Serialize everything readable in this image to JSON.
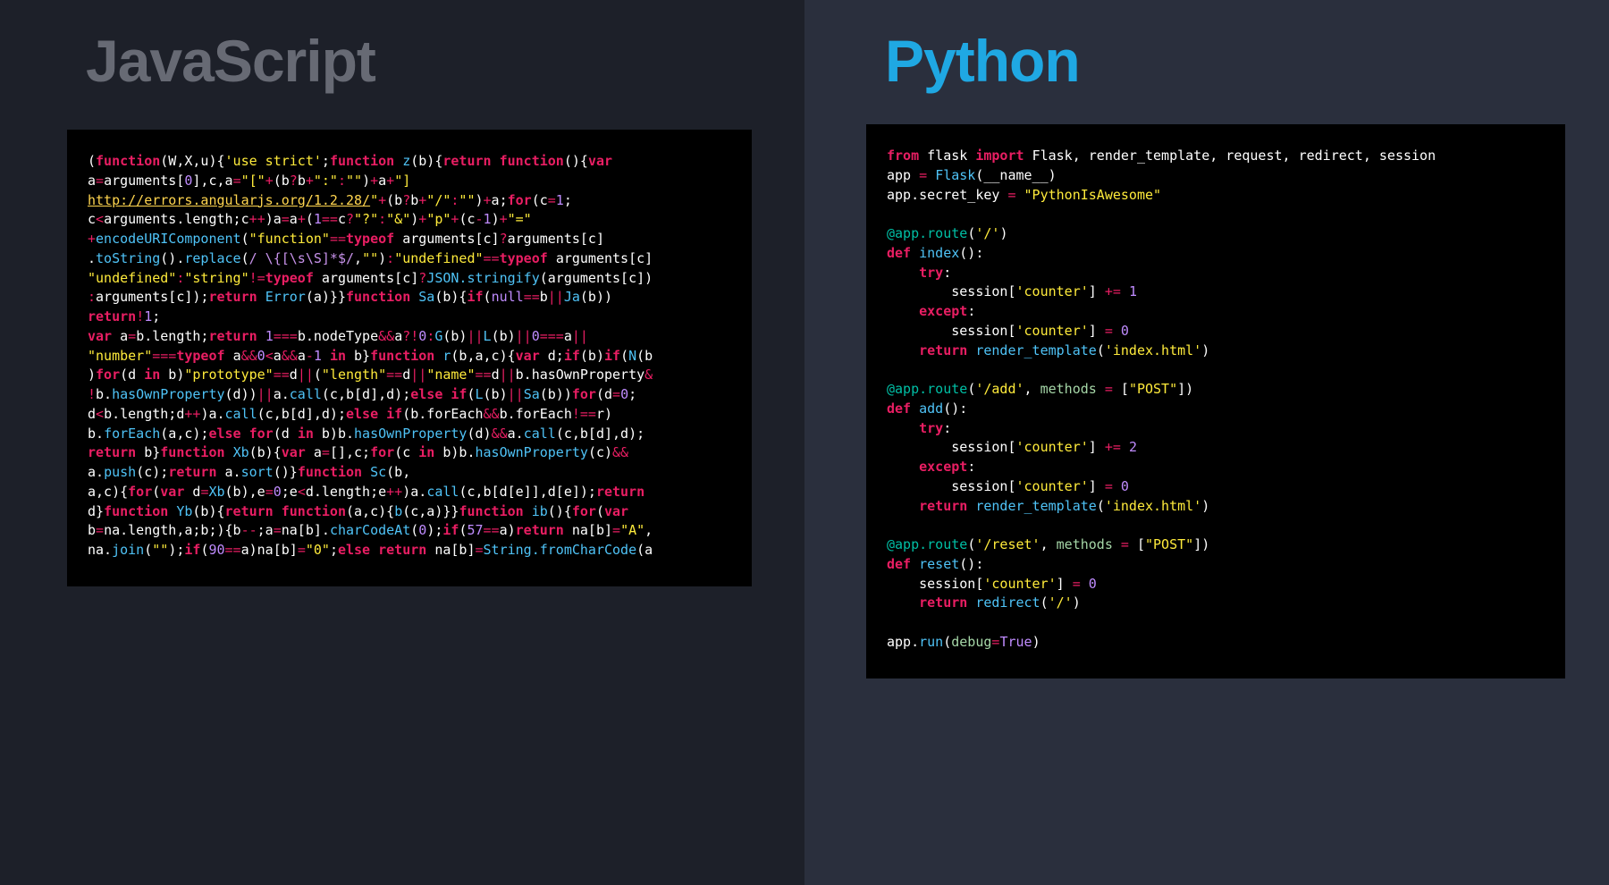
{
  "left": {
    "title": "JavaScript",
    "code_html": "<span class='wht'>(</span><span class='kw'>function</span><span class='wht'>(W,X,u){</span><span class='str'>'use strict'</span><span class='wht'>;</span><span class='kw'>function</span> <span class='fn'>z</span><span class='wht'>(b){</span><span class='kw'>return</span> <span class='kw'>function</span><span class='wht'>(){</span><span class='kw'>var</span>\n<span class='wht'>a</span><span class='op'>=</span><span class='wht'>arguments[</span><span class='num'>0</span><span class='wht'>],c,a</span><span class='op'>=</span><span class='str'>\"[\"</span><span class='op'>+</span><span class='wht'>(b</span><span class='op'>?</span><span class='wht'>b</span><span class='op'>+</span><span class='str'>\":\"</span><span class='op'>:</span><span class='str'>\"\"</span><span class='wht'>)</span><span class='op'>+</span><span class='wht'>a</span><span class='op'>+</span><span class='str'>\"]</span>\n<span class='url'>http://errors.angularjs.org/1.2.28/</span><span class='str'>\"</span><span class='op'>+</span><span class='wht'>(b</span><span class='op'>?</span><span class='wht'>b</span><span class='op'>+</span><span class='str'>\"/\"</span><span class='op'>:</span><span class='str'>\"\"</span><span class='wht'>)</span><span class='op'>+</span><span class='wht'>a;</span><span class='kw'>for</span><span class='wht'>(c</span><span class='op'>=</span><span class='num'>1</span><span class='wht'>;\nc</span><span class='op'>&lt;</span><span class='wht'>arguments.length;c</span><span class='op'>++</span><span class='wht'>)a</span><span class='op'>=</span><span class='wht'>a</span><span class='op'>+</span><span class='wht'>(</span><span class='num'>1</span><span class='op'>==</span><span class='wht'>c</span><span class='op'>?</span><span class='str'>\"?\"</span><span class='op'>:</span><span class='str'>\"&amp;\"</span><span class='wht'>)</span><span class='op'>+</span><span class='str'>\"p\"</span><span class='op'>+</span><span class='wht'>(c</span><span class='op'>-</span><span class='num'>1</span><span class='wht'>)</span><span class='op'>+</span><span class='str'>\"=\"</span>\n<span class='op'>+</span><span class='fn'>encodeURIComponent</span><span class='wht'>(</span><span class='str'>\"function\"</span><span class='op'>==</span><span class='kw'>typeof</span> <span class='wht'>arguments[c]</span><span class='op'>?</span><span class='wht'>arguments[c]</span>\n<span class='wht'>.</span><span class='fn'>toString</span><span class='wht'>().</span><span class='fn'>replace</span><span class='wht'>(</span><span class='lav'>/ \\{[\\s\\S]*$/</span><span class='wht'>,</span><span class='str'>\"\"</span><span class='wht'>)</span><span class='op'>:</span><span class='str'>\"undefined\"</span><span class='op'>==</span><span class='kw'>typeof</span> <span class='wht'>arguments[c]</span>\n<span class='str'>\"undefined\"</span><span class='op'>:</span><span class='str'>\"string\"</span><span class='op'>!=</span><span class='kw'>typeof</span> <span class='wht'>arguments[c]</span><span class='op'>?</span><span class='fn'>JSON.stringify</span><span class='wht'>(arguments[c])</span>\n<span class='op'>:</span><span class='wht'>arguments[c]);</span><span class='kw'>return</span> <span class='fn'>Error</span><span class='wht'>(a)}}</span><span class='kw'>function</span> <span class='fn'>Sa</span><span class='wht'>(b){</span><span class='kw'>if</span><span class='wht'>(</span><span class='num'>null</span><span class='op'>==</span><span class='wht'>b</span><span class='op'>||</span><span class='fn'>Ja</span><span class='wht'>(b))</span>\n<span class='kw'>return</span><span class='op'>!</span><span class='num'>1</span><span class='wht'>;</span>\n<span class='kw'>var</span> <span class='wht'>a</span><span class='op'>=</span><span class='wht'>b.length;</span><span class='kw'>return</span> <span class='num'>1</span><span class='op'>===</span><span class='wht'>b.nodeType</span><span class='op'>&amp;&amp;</span><span class='wht'>a</span><span class='op'>?!</span><span class='num'>0</span><span class='op'>:</span><span class='fn'>G</span><span class='wht'>(b)</span><span class='op'>||</span><span class='fn'>L</span><span class='wht'>(b)</span><span class='op'>||</span><span class='num'>0</span><span class='op'>===</span><span class='wht'>a</span><span class='op'>||</span>\n<span class='str'>\"number\"</span><span class='op'>===</span><span class='kw'>typeof</span> <span class='wht'>a</span><span class='op'>&amp;&amp;</span><span class='num'>0</span><span class='op'>&lt;</span><span class='wht'>a</span><span class='op'>&amp;&amp;</span><span class='wht'>a</span><span class='op'>-</span><span class='num'>1</span> <span class='kw'>in</span> <span class='wht'>b}</span><span class='kw'>function</span> <span class='fn'>r</span><span class='wht'>(b,a,c){</span><span class='kw'>var</span> <span class='wht'>d;</span><span class='kw'>if</span><span class='wht'>(b)</span><span class='kw'>if</span><span class='wht'>(</span><span class='fn'>N</span><span class='wht'>(b</span>\n<span class='wht'>)</span><span class='kw'>for</span><span class='wht'>(d </span><span class='kw'>in</span><span class='wht'> b)</span><span class='str'>\"prototype\"</span><span class='op'>==</span><span class='wht'>d</span><span class='op'>||</span><span class='wht'>(</span><span class='str'>\"length\"</span><span class='op'>==</span><span class='wht'>d</span><span class='op'>||</span><span class='str'>\"name\"</span><span class='op'>==</span><span class='wht'>d</span><span class='op'>||</span><span class='wht'>b.hasOwnProperty</span><span class='op'>&amp;</span>\n<span class='op'>!</span><span class='wht'>b.</span><span class='fn'>hasOwnProperty</span><span class='wht'>(d))</span><span class='op'>||</span><span class='wht'>a.</span><span class='fn'>call</span><span class='wht'>(c,b[d],d);</span><span class='kw'>else if</span><span class='wht'>(</span><span class='fn'>L</span><span class='wht'>(b)</span><span class='op'>||</span><span class='fn'>Sa</span><span class='wht'>(b))</span><span class='kw'>for</span><span class='wht'>(d</span><span class='op'>=</span><span class='num'>0</span><span class='wht'>;</span>\n<span class='wht'>d</span><span class='op'>&lt;</span><span class='wht'>b.length;d</span><span class='op'>++</span><span class='wht'>)a.</span><span class='fn'>call</span><span class='wht'>(c,b[d],d);</span><span class='kw'>else if</span><span class='wht'>(b.forEach</span><span class='op'>&amp;&amp;</span><span class='wht'>b.forEach</span><span class='op'>!==</span><span class='wht'>r)</span>\n<span class='wht'>b.</span><span class='fn'>forEach</span><span class='wht'>(a,c);</span><span class='kw'>else for</span><span class='wht'>(d </span><span class='kw'>in</span><span class='wht'> b)b.</span><span class='fn'>hasOwnProperty</span><span class='wht'>(d)</span><span class='op'>&amp;&amp;</span><span class='wht'>a.</span><span class='fn'>call</span><span class='wht'>(c,b[d],d);</span>\n<span class='kw'>return</span> <span class='wht'>b}</span><span class='kw'>function</span> <span class='fn'>Xb</span><span class='wht'>(b){</span><span class='kw'>var</span> <span class='wht'>a</span><span class='op'>=</span><span class='wht'>[],c;</span><span class='kw'>for</span><span class='wht'>(c </span><span class='kw'>in</span><span class='wht'> b)b.</span><span class='fn'>hasOwnProperty</span><span class='wht'>(c)</span><span class='op'>&amp;&amp;</span>\n<span class='wht'>a.</span><span class='fn'>push</span><span class='wht'>(c);</span><span class='kw'>return</span> <span class='wht'>a.</span><span class='fn'>sort</span><span class='wht'>()}</span><span class='kw'>function</span> <span class='fn'>Sc</span><span class='wht'>(b,</span>\n<span class='wht'>a,c){</span><span class='kw'>for</span><span class='wht'>(</span><span class='kw'>var</span> <span class='wht'>d</span><span class='op'>=</span><span class='fn'>Xb</span><span class='wht'>(b),e</span><span class='op'>=</span><span class='num'>0</span><span class='wht'>;e</span><span class='op'>&lt;</span><span class='wht'>d.length;e</span><span class='op'>++</span><span class='wht'>)a.</span><span class='fn'>call</span><span class='wht'>(c,b[d[e]],d[e]);</span><span class='kw'>return</span>\n<span class='wht'>d}</span><span class='kw'>function</span> <span class='fn'>Yb</span><span class='wht'>(b){</span><span class='kw'>return</span> <span class='kw'>function</span><span class='wht'>(a,c){</span><span class='fn'>b</span><span class='wht'>(c,a)}}</span><span class='kw'>function</span> <span class='fn'>ib</span><span class='wht'>(){</span><span class='kw'>for</span><span class='wht'>(</span><span class='kw'>var</span>\n<span class='wht'>b</span><span class='op'>=</span><span class='wht'>na.length,a;b;){b</span><span class='op'>--</span><span class='wht'>;a</span><span class='op'>=</span><span class='wht'>na[b].</span><span class='fn'>charCodeAt</span><span class='wht'>(</span><span class='num'>0</span><span class='wht'>);</span><span class='kw'>if</span><span class='wht'>(</span><span class='num'>57</span><span class='op'>==</span><span class='wht'>a)</span><span class='kw'>return</span> <span class='wht'>na[b]</span><span class='op'>=</span><span class='str'>\"A\"</span><span class='wht'>,</span>\n<span class='wht'>na.</span><span class='fn'>join</span><span class='wht'>(</span><span class='str'>\"\"</span><span class='wht'>);</span><span class='kw'>if</span><span class='wht'>(</span><span class='num'>90</span><span class='op'>==</span><span class='wht'>a)na[b]</span><span class='op'>=</span><span class='str'>\"0\"</span><span class='wht'>;</span><span class='kw'>else return</span> <span class='wht'>na[b]</span><span class='op'>=</span><span class='fn'>String.fromCharCode</span><span class='wht'>(a</span>"
  },
  "right": {
    "title": "Python",
    "code_html": "<span class='kw'>from</span> <span class='wht'>flask</span> <span class='kw'>import</span> <span class='wht'>Flask, render_template, request, redirect, session</span>\n<span class='wht'>app</span> <span class='op'>=</span> <span class='fn'>Flask</span><span class='wht'>(__name__)</span>\n<span class='wht'>app.secret_key</span> <span class='op'>=</span> <span class='str'>\"PythonIsAwesome\"</span>\n\n<span class='deco'>@app.route</span><span class='wht'>(</span><span class='str'>'/'</span><span class='wht'>)</span>\n<span class='kw'>def</span> <span class='fn'>index</span><span class='wht'>():</span>\n    <span class='kw'>try</span><span class='wht'>:</span>\n        <span class='wht'>session[</span><span class='str'>'counter'</span><span class='wht'>]</span> <span class='op'>+=</span> <span class='num'>1</span>\n    <span class='kw'>except</span><span class='wht'>:</span>\n        <span class='wht'>session[</span><span class='str'>'counter'</span><span class='wht'>]</span> <span class='op'>=</span> <span class='num'>0</span>\n    <span class='kw'>return</span> <span class='fn'>render_template</span><span class='wht'>(</span><span class='str'>'index.html'</span><span class='wht'>)</span>\n\n<span class='deco'>@app.route</span><span class='wht'>(</span><span class='str'>'/add'</span><span class='wht'>,</span> <span class='name'>methods</span> <span class='op'>=</span> <span class='wht'>[</span><span class='str'>\"POST\"</span><span class='wht'>])</span>\n<span class='kw'>def</span> <span class='fn'>add</span><span class='wht'>():</span>\n    <span class='kw'>try</span><span class='wht'>:</span>\n        <span class='wht'>session[</span><span class='str'>'counter'</span><span class='wht'>]</span> <span class='op'>+=</span> <span class='num'>2</span>\n    <span class='kw'>except</span><span class='wht'>:</span>\n        <span class='wht'>session[</span><span class='str'>'counter'</span><span class='wht'>]</span> <span class='op'>=</span> <span class='num'>0</span>\n    <span class='kw'>return</span> <span class='fn'>render_template</span><span class='wht'>(</span><span class='str'>'index.html'</span><span class='wht'>)</span>\n\n<span class='deco'>@app.route</span><span class='wht'>(</span><span class='str'>'/reset'</span><span class='wht'>,</span> <span class='name'>methods</span> <span class='op'>=</span> <span class='wht'>[</span><span class='str'>\"POST\"</span><span class='wht'>])</span>\n<span class='kw'>def</span> <span class='fn'>reset</span><span class='wht'>():</span>\n    <span class='wht'>session[</span><span class='str'>'counter'</span><span class='wht'>]</span> <span class='op'>=</span> <span class='num'>0</span>\n    <span class='kw'>return</span> <span class='fn'>redirect</span><span class='wht'>(</span><span class='str'>'/'</span><span class='wht'>)</span>\n\n<span class='wht'>app.</span><span class='fn'>run</span><span class='wht'>(</span><span class='name'>debug</span><span class='op'>=</span><span class='num'>True</span><span class='wht'>)</span>"
  }
}
